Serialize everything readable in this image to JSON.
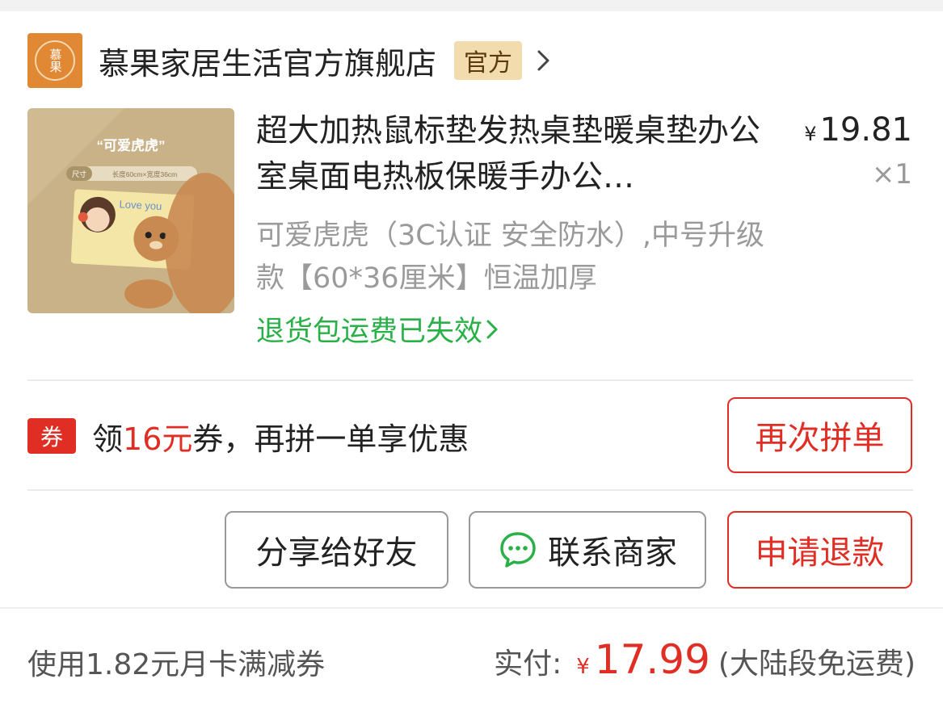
{
  "store": {
    "logo_text": "慕果",
    "name": "慕果家居生活官方旗舰店",
    "badge": "官方"
  },
  "product": {
    "image_caption": "“可爱虎虎”",
    "image_size_label": "尺寸",
    "image_size_text": "长度60cm×宽度36cm",
    "image_love_text": "Love you",
    "title": "超大加热鼠标垫发热桌垫暖桌垫办公室桌面电热板保暖手办公…",
    "price_symbol": "¥",
    "price": "19.81",
    "quantity": "×1",
    "spec": "可爱虎虎（3C认证 安全防水）,中号升级款【60*36厘米】恒温加厚",
    "return_insurance": "退货包运费已失效"
  },
  "coupon": {
    "tag": "券",
    "text_before": "领",
    "amount": "16元",
    "text_after": "券，再拼一单享优惠"
  },
  "buttons": {
    "regroup": "再次拼单",
    "share": "分享给好友",
    "contact": "联系商家",
    "refund": "申请退款"
  },
  "footer": {
    "discount_text": "使用1.82元月卡满减券",
    "paid_label": "实付:",
    "paid_symbol": "¥",
    "paid_amount": "17.99",
    "shipping_note": "(大陆段免运费)"
  },
  "colors": {
    "accent_red": "#e02e24",
    "green": "#29b047",
    "badge_gold": "#f2dcae",
    "logo_orange": "#e08834"
  }
}
